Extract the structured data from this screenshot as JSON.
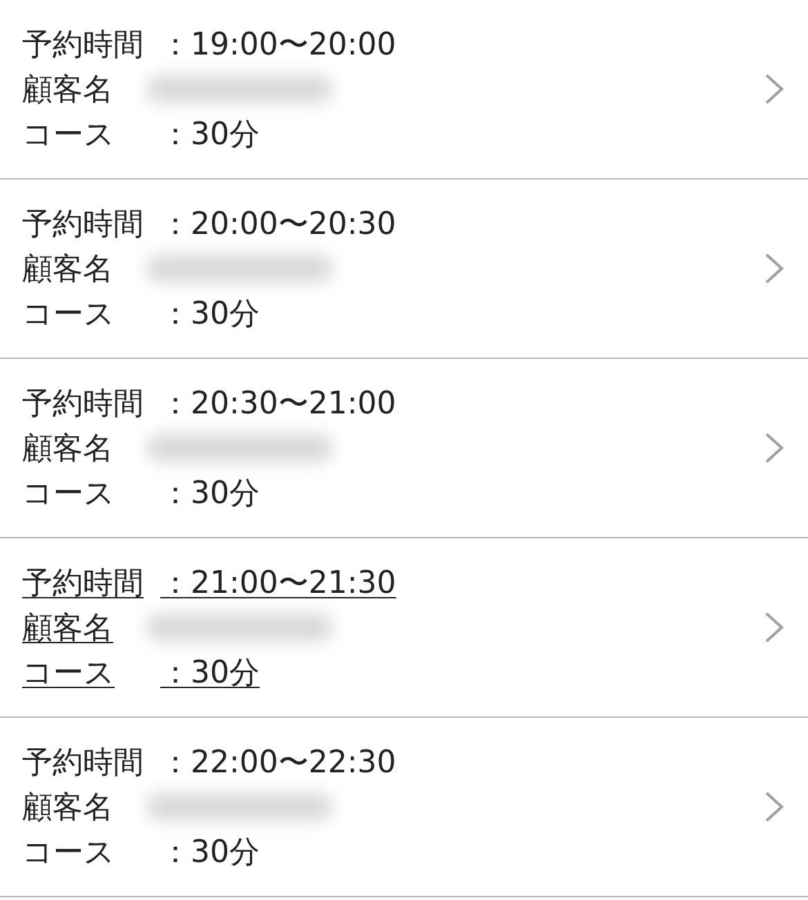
{
  "reservations": [
    {
      "underlined": false,
      "lines": [
        {
          "kind": "text",
          "label": "予約時間",
          "separator": "：",
          "value": "19:00〜20:00"
        },
        {
          "kind": "redacted",
          "label": "顧客名"
        },
        {
          "kind": "text",
          "label": "コース",
          "separator": "：",
          "value": "30分"
        }
      ]
    },
    {
      "underlined": false,
      "lines": [
        {
          "kind": "text",
          "label": "予約時間",
          "separator": "：",
          "value": "20:00〜20:30"
        },
        {
          "kind": "redacted",
          "label": "顧客名"
        },
        {
          "kind": "text",
          "label": "コース",
          "separator": "：",
          "value": "30分"
        }
      ]
    },
    {
      "underlined": false,
      "lines": [
        {
          "kind": "text",
          "label": "予約時間",
          "separator": "：",
          "value": "20:30〜21:00"
        },
        {
          "kind": "redacted",
          "label": "顧客名"
        },
        {
          "kind": "text",
          "label": "コース",
          "separator": "：",
          "value": "30分"
        }
      ]
    },
    {
      "underlined": true,
      "lines": [
        {
          "kind": "text",
          "label": "予約時間",
          "separator": "：",
          "value": "21:00〜21:30"
        },
        {
          "kind": "redacted",
          "label": "顧客名"
        },
        {
          "kind": "text",
          "label": "コース",
          "separator": "：",
          "value": "30分"
        }
      ]
    },
    {
      "underlined": false,
      "lines": [
        {
          "kind": "text",
          "label": "予約時間",
          "separator": "：",
          "value": "22:00〜22:30"
        },
        {
          "kind": "redacted",
          "label": "顧客名"
        },
        {
          "kind": "text",
          "label": "コース",
          "separator": "：",
          "value": "30分"
        }
      ]
    }
  ]
}
